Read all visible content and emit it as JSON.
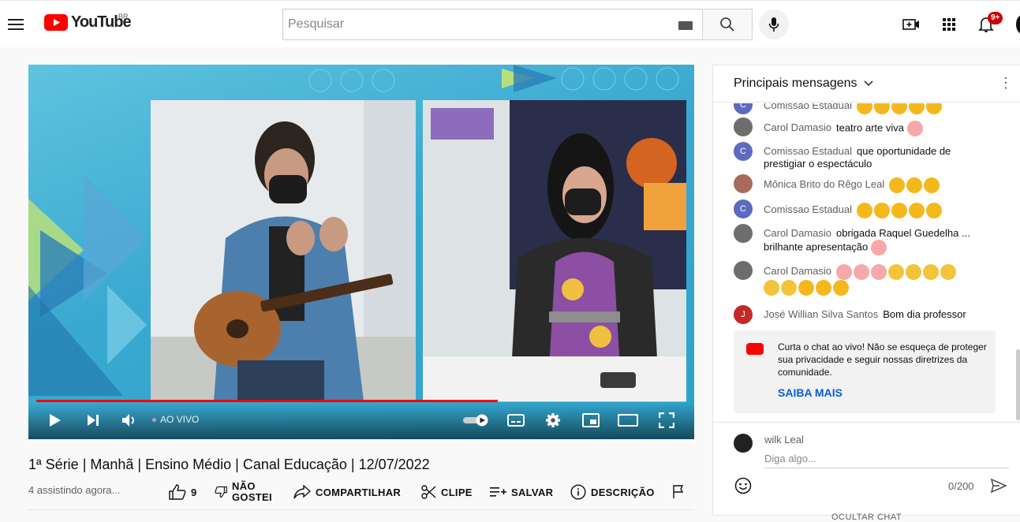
{
  "header": {
    "logo_text": "YouTube",
    "country_code": "BR",
    "search_placeholder": "Pesquisar",
    "notification_count": "9+"
  },
  "player": {
    "live_label": "AO VIVO",
    "progress_fraction": 0.71,
    "accent": "#ff0000"
  },
  "video": {
    "title": "1ª Série | Manhã | Ensino Médio | Canal Educação | 12/07/2022",
    "viewers": "4 assistindo agora...",
    "like_count": "9",
    "dislike_label_1": "NÃO",
    "dislike_label_2": "GOSTEI",
    "share_label": "COMPARTILHAR",
    "clip_label": "CLIPE",
    "save_label": "SALVAR",
    "description_label": "DESCRIÇÃO"
  },
  "chat": {
    "header_title": "Principais mensagens",
    "messages": [
      {
        "author": "Comissao Estadual",
        "text": "",
        "emoji": "clap",
        "emoji_count": 5,
        "avatar_letter": "C",
        "avatar_color": "#5c6bc0"
      },
      {
        "author": "Carol Damasio",
        "text": "teatro arte viva",
        "emoji": "hug-face",
        "emoji_count": 1,
        "avatar_letter": "",
        "avatar_color": "#6d6d6d"
      },
      {
        "author": "Comissao Estadual",
        "text": "que oportunidade de prestigiar o espectáculo",
        "emoji": "",
        "emoji_count": 0,
        "avatar_letter": "C",
        "avatar_color": "#5c6bc0"
      },
      {
        "author": "Mônica Brito do Rêgo Leal",
        "text": "",
        "emoji": "clap",
        "emoji_count": 3,
        "avatar_letter": "",
        "avatar_color": "#a86a5a"
      },
      {
        "author": "Comissao Estadual",
        "text": "",
        "emoji": "clap",
        "emoji_count": 5,
        "avatar_letter": "C",
        "avatar_color": "#5c6bc0"
      },
      {
        "author": "Carol Damasio",
        "text": "obrigada Raquel Guedelha ... brilhante apresentação",
        "emoji": "hug-face",
        "emoji_count": 1,
        "avatar_letter": "",
        "avatar_color": "#6d6d6d"
      },
      {
        "author": "Carol Damasio",
        "text": "",
        "emoji": "mixed-faces",
        "emoji_count": 12,
        "avatar_letter": "",
        "avatar_color": "#6d6d6d"
      },
      {
        "author": "José Willian Silva Santos",
        "text": "Bom dia professor",
        "emoji": "",
        "emoji_count": 0,
        "avatar_letter": "J",
        "avatar_color": "#c62828"
      }
    ],
    "notice_text": "Curta o chat ao vivo! Não se esqueça de proteger sua privacidade e seguir nossas diretrizes da comunidade.",
    "notice_link": "SAIBA MAIS",
    "input_user": "wilk Leal",
    "input_placeholder": "Diga algo...",
    "char_count": "0/200",
    "hide_chat_label": "OCULTAR CHAT"
  }
}
